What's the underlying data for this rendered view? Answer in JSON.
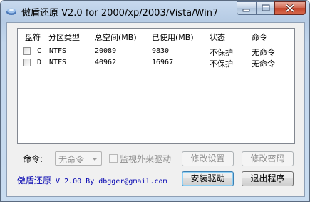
{
  "window": {
    "title": "傲盾还原 V2.0 for 2000/xp/2003/Vista/Win7",
    "buttons": {
      "minimize": "",
      "maximize": "",
      "close": ""
    }
  },
  "columns": [
    "盘符",
    "分区类型",
    "总空间(MB)",
    "已使用(MB)",
    "状态",
    "命令"
  ],
  "rows": [
    {
      "checked": false,
      "drive": "C",
      "type": "NTFS",
      "total": "20089",
      "used": "9830",
      "status": "不保护",
      "command": "无命令"
    },
    {
      "checked": false,
      "drive": "D",
      "type": "NTFS",
      "total": "40962",
      "used": "16967",
      "status": "不保护",
      "command": "无命令"
    }
  ],
  "controls": {
    "command_label": "命令:",
    "command_select_value": "无命令",
    "monitor_checkbox_label": "监视外来驱动",
    "modify_settings_button": "修改设置",
    "change_password_button": "修改密码"
  },
  "footer": {
    "credit_name": "傲盾还原",
    "credit_rest": " V 2.00 By dbgger@gmail.com",
    "install_driver_button": "安装驱动",
    "exit_button": "退出程序"
  }
}
